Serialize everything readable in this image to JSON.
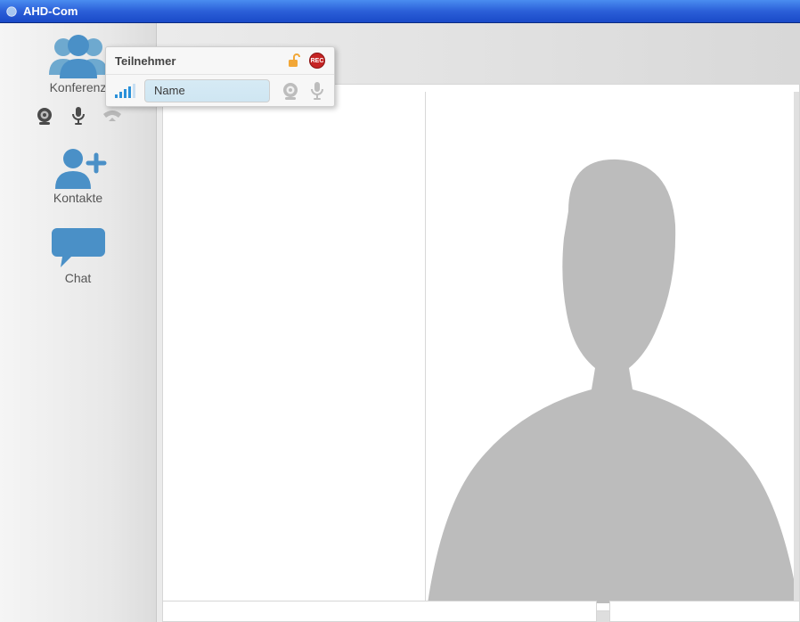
{
  "window": {
    "title": "AHD-Com"
  },
  "sidebar": {
    "items": [
      {
        "label": "Konferenz"
      },
      {
        "label": "Kontakte"
      },
      {
        "label": "Chat"
      }
    ]
  },
  "participants": {
    "header_label": "Teilnehmer",
    "rec_label": "REC",
    "rows": [
      {
        "name": "Name"
      }
    ]
  },
  "colors": {
    "accent": "#4a90c7",
    "accent_fill": "#6ea9cf"
  }
}
